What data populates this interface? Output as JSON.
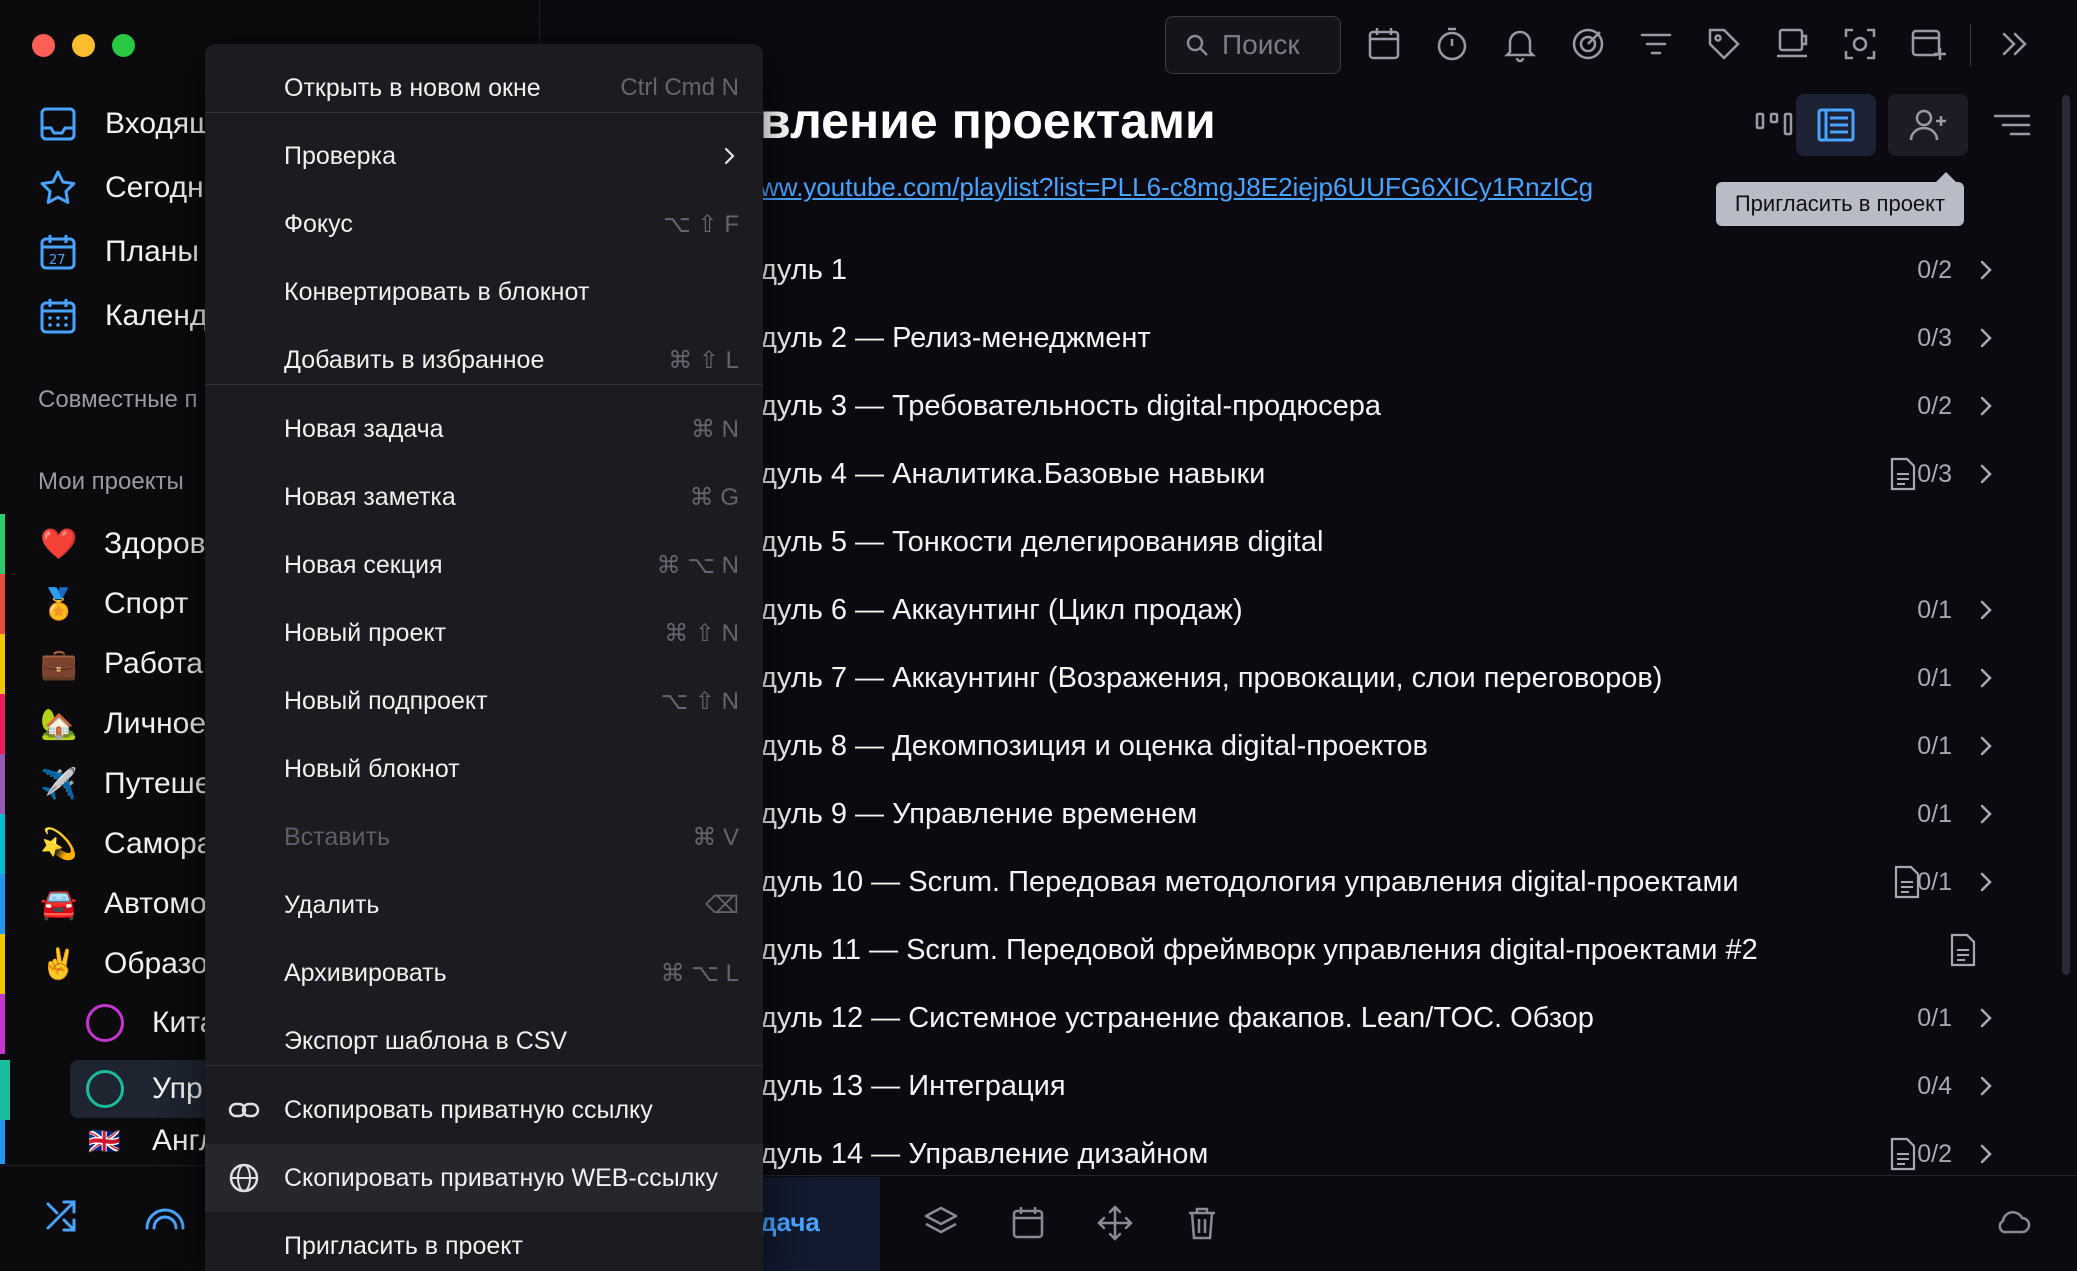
{
  "sidebar": {
    "nav": [
      {
        "label": "Входящ",
        "icon": "inbox-icon"
      },
      {
        "label": "Сегодн",
        "icon": "star-icon"
      },
      {
        "label": "Планы",
        "icon": "calendar-27-icon"
      },
      {
        "label": "Календ",
        "icon": "calendar-grid-icon"
      }
    ],
    "shared_header": "Совместные п",
    "my_projects_header": "Мои проекты",
    "projects": [
      {
        "emoji": "❤️",
        "label": "Здоров",
        "color": "#2ecc71"
      },
      {
        "emoji": "🏅",
        "label": "Спорт",
        "color": "#e74c3c"
      },
      {
        "emoji": "💼",
        "label": "Работа",
        "color": "#f1c40f"
      },
      {
        "emoji": "🏡",
        "label": "Личное",
        "color": "#e91e63"
      },
      {
        "emoji": "✈️",
        "label": "Путеше",
        "color": "#9b59b6"
      },
      {
        "emoji": "💫",
        "label": "Самора",
        "color": "#00bcd4"
      },
      {
        "emoji": "🚘",
        "label": "Автомо",
        "color": "#2196f3"
      },
      {
        "emoji": "✌️",
        "label": "Образо",
        "color": "#f1c40f"
      }
    ],
    "subprojects": [
      {
        "label": "Кита",
        "ring_color": "#c436cf",
        "bar_color": "#c436cf"
      },
      {
        "label": "Упр",
        "ring_color": "#1abc9c",
        "bar_color": "#1abc9c"
      },
      {
        "emoji": "🇬🇧",
        "label": "Англ",
        "bar_color": "#2196f3"
      }
    ]
  },
  "toolbar": {
    "search_placeholder": "Поиск"
  },
  "project": {
    "title": "вление проектами",
    "link": "ww.youtube.com/playlist?list=PLL6-c8mgJ8E2iejp6UUFG6XICy1RnzICg",
    "tooltip": "Пригласить в проект"
  },
  "tasks": [
    {
      "title": "дуль 1",
      "count": "0/2",
      "note": false,
      "chevron": true
    },
    {
      "title": "дуль 2 — Релиз-менеджмент",
      "count": "0/3",
      "note": false,
      "chevron": true
    },
    {
      "title": "дуль 3 — Требовательность digital-продюсера",
      "count": "0/2",
      "note": false,
      "chevron": true
    },
    {
      "title": "дуль 4 — Аналитика.Базовые навыки",
      "count": "0/3",
      "note": true,
      "chevron": true
    },
    {
      "title": "дуль 5 — Тонкости делегированияв digital",
      "count": "",
      "note": false,
      "chevron": false
    },
    {
      "title": "дуль 6 — Аккаунтинг (Цикл продаж)",
      "count": "0/1",
      "note": false,
      "chevron": true
    },
    {
      "title": "дуль 7 — Аккаунтинг (Возражения, провокации, слои переговоров)",
      "count": "0/1",
      "note": false,
      "chevron": true
    },
    {
      "title": "дуль 8 — Декомпозиция и оценка digital-проектов",
      "count": "0/1",
      "note": false,
      "chevron": true
    },
    {
      "title": "дуль 9 — Управление временем",
      "count": "0/1",
      "note": false,
      "chevron": true
    },
    {
      "title": "дуль 10 — Scrum. Передовая методология управления digital-проектами",
      "count": "0/1",
      "note": true,
      "chevron": true
    },
    {
      "title": "дуль 11 — Scrum. Передовой фреймворк управления digital-проектами #2",
      "count": "",
      "note": true,
      "chevron": false
    },
    {
      "title": "дуль 12 — Системное устранение факапов. Lean/TOC. Обзор",
      "count": "0/1",
      "note": false,
      "chevron": true
    },
    {
      "title": "дуль 13 — Интеграция",
      "count": "0/4",
      "note": false,
      "chevron": true
    },
    {
      "title": "дуль 14 — Управление дизайном",
      "count": "0/2",
      "note": true,
      "chevron": true
    }
  ],
  "bottom_bar": {
    "active_label": "дача"
  },
  "context_menu": {
    "items": [
      {
        "label": "Открыть в новом окне",
        "shortcut": "Ctrl Cmd N"
      },
      {
        "label": "Проверка",
        "shortcut": "",
        "submenu": true
      },
      {
        "label": "Фокус",
        "shortcut": "⌥ ⇧ F"
      },
      {
        "label": "Конвертировать в блокнот",
        "shortcut": ""
      },
      {
        "label": "Добавить в избранное",
        "shortcut": "⌘ ⇧ L"
      },
      {
        "label": "Новая задача",
        "shortcut": "⌘ N"
      },
      {
        "label": "Новая заметка",
        "shortcut": "⌘ G"
      },
      {
        "label": "Новая секция",
        "shortcut": "⌘ ⌥ N"
      },
      {
        "label": "Новый проект",
        "shortcut": "⌘ ⇧ N"
      },
      {
        "label": "Новый подпроект",
        "shortcut": "⌥ ⇧ N"
      },
      {
        "label": "Новый блокнот",
        "shortcut": ""
      },
      {
        "label": "Вставить",
        "shortcut": "⌘ V",
        "disabled": true
      },
      {
        "label": "Удалить",
        "shortcut": "⌫"
      },
      {
        "label": "Архивировать",
        "shortcut": "⌘ ⌥ L"
      },
      {
        "label": "Экспорт шаблона в CSV",
        "shortcut": ""
      },
      {
        "label": "Скопировать приватную ссылку",
        "shortcut": "",
        "icon": "link-icon"
      },
      {
        "label": "Скопировать приватную WEB-ссылку",
        "shortcut": "",
        "icon": "globe-icon",
        "highlighted": true
      },
      {
        "label": "Пригласить в проект",
        "shortcut": ""
      }
    ]
  },
  "colors": {
    "accent": "#4aa3ff",
    "background": "#0a0a10",
    "menu_background": "#1b1b20"
  }
}
